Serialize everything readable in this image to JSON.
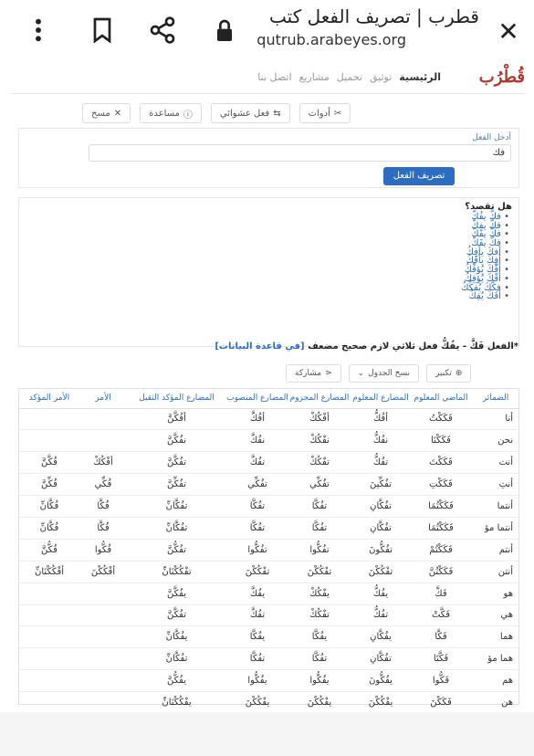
{
  "browser": {
    "page_title": "قطرب | تصريف الفعل كتب",
    "url": "qutrub.arabeyes.org"
  },
  "nav": {
    "logo": "قُطْرُب",
    "links": [
      "الرئيسية",
      "توثيق",
      "تحميل",
      "مشاريع",
      "اتصل بنا"
    ]
  },
  "toolbar": {
    "tools": "أدوات",
    "random_verb": "فعل عشوائي",
    "help": "مساعدة",
    "clear": "مسح"
  },
  "form": {
    "label": "أدخل الفعل",
    "input_value": "فك",
    "submit": "تصريف الفعل"
  },
  "suggestions": {
    "title": "هل تقصد؟",
    "items": [
      "فكَّ  يفُكّ",
      "فكَّ  يفِكّ",
      "فكَّ  يفَكّ",
      "فكَّ  يفَكّ",
      "أفكَ  يأفِكُ",
      "أفِكَ  يأفَكُ",
      "أفَّكَ  يُؤفِّكُ",
      "أفْكَ  يُؤفِكُ",
      "فكَّكَ  يُفكِّكُ",
      "أفَكَ  يُفِكُ"
    ]
  },
  "result": {
    "prefix": "*الفعل فَكَّ - يفُكُّ فعل ثلاثي لازم صحيح مضعف",
    "db_note": "[في قاعدة البيانات]"
  },
  "table_actions": {
    "zoom": "تكبير",
    "copy": "نسخ الجدول",
    "share": "مشاركة"
  },
  "table": {
    "headers": [
      "الضمائر",
      "الماضي المعلوم",
      "المضارع المعلوم",
      "المضارع المجزوم",
      "المضارع المنصوب",
      "المضارع المؤكد الثقيل",
      "الأمر",
      "الأمر المؤكد"
    ],
    "rows": [
      [
        "أنا",
        "فَكَكْتُ",
        "أفُكُّ",
        "أفْكُكْ",
        "أفُكَّ",
        "أفُكَّنَّ",
        "",
        ""
      ],
      [
        "نحن",
        "فَكَكْنَا",
        "نفُكُّ",
        "نفْكُكْ",
        "نفُكَّ",
        "نفُكَّنَّ",
        "",
        ""
      ],
      [
        "أنت",
        "فَكَكْتَ",
        "تفُكُّ",
        "تفْكُكْ",
        "تفُكَّ",
        "تفُكَّنَّ",
        "أفْكُكْ",
        "فُكَّنَّ"
      ],
      [
        "أنتِ",
        "فَكَكْتِ",
        "تفُكِّينَ",
        "تفُكِّي",
        "تفُكِّي",
        "تفُكِّنَّ",
        "فُكِّي",
        "فُكِّنَّ"
      ],
      [
        "أنتما",
        "فَكَكْتُمَا",
        "تفُكَّانِ",
        "تفُكَّا",
        "تفُكَّا",
        "تفُكَّانِّ",
        "فُكَّا",
        "فُكَّانِّ"
      ],
      [
        "أنتما مؤ",
        "فَكَكْتُمَا",
        "تفُكَّانِ",
        "تفُكَّا",
        "تفُكَّا",
        "تفُكَّانِّ",
        "فُكَّا",
        "فُكَّانِّ"
      ],
      [
        "أنتم",
        "فَكَكْتُمْ",
        "تفُكُّونَ",
        "تفُكُّوا",
        "تفُكُّوا",
        "تفُكُّنَّ",
        "فُكُّوا",
        "فُكُّنَّ"
      ],
      [
        "أنتن",
        "فَكَكْتُنَّ",
        "تفْكُكْنَ",
        "تفْكُكْنَ",
        "تفْكُكْنَ",
        "تفْكُكْنَانِّ",
        "أفْكُكْنَ",
        "أفْكُكْنَانِّ"
      ],
      [
        "هو",
        "فَكَّ",
        "يفُكُّ",
        "يفْكُكْ",
        "يفُكَّ",
        "يفُكَّنَّ",
        "",
        ""
      ],
      [
        "هي",
        "فَكَّتْ",
        "تفُكُّ",
        "تفْكُكْ",
        "تفُكَّ",
        "تفُكَّنَّ",
        "",
        ""
      ],
      [
        "هما",
        "فَكَّا",
        "يفُكَّانِ",
        "يفُكَّا",
        "يفُكَّا",
        "يفُكَّانِّ",
        "",
        ""
      ],
      [
        "هما مؤ",
        "فَكَّتَا",
        "تفُكَّانِ",
        "تفُكَّا",
        "تفُكَّا",
        "تفُكَّانِّ",
        "",
        ""
      ],
      [
        "هم",
        "فَكُّوا",
        "يفُكُّونَ",
        "يفُكُّوا",
        "يفُكُّوا",
        "يفُكُّنَّ",
        "",
        ""
      ],
      [
        "هن",
        "فَكَكْنَ",
        "يفْكُكْنَ",
        "يفْكُكْنَ",
        "يفْكُكْنَ",
        "يفْكُكْنَانِّ",
        "",
        ""
      ]
    ]
  }
}
